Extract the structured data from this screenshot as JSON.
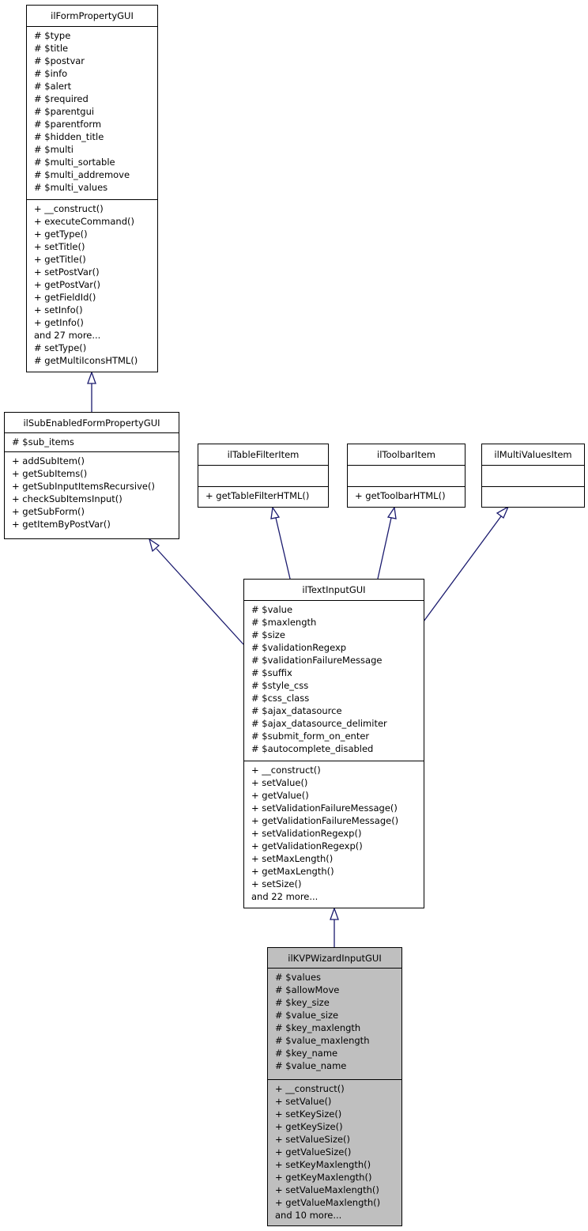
{
  "diagram": {
    "type": "uml-class-inheritance",
    "edge_color": "#1a1a6e",
    "focus_fill": "#bfbfbf",
    "classes": {
      "form_property": {
        "name": "ilFormPropertyGUI",
        "attributes": [
          "# $type",
          "# $title",
          "# $postvar",
          "# $info",
          "# $alert",
          "# $required",
          "# $parentgui",
          "# $parentform",
          "# $hidden_title",
          "# $multi",
          "# $multi_sortable",
          "# $multi_addremove",
          "# $multi_values"
        ],
        "methods": [
          "+ __construct()",
          "+ executeCommand()",
          "+ getType()",
          "+ setTitle()",
          "+ getTitle()",
          "+ setPostVar()",
          "+ getPostVar()",
          "+ getFieldId()",
          "+ setInfo()",
          "+ getInfo()",
          "and 27 more...",
          "# setType()",
          "# getMultiIconsHTML()"
        ]
      },
      "sub_enabled": {
        "name": "ilSubEnabledFormPropertyGUI",
        "attributes": [
          "# $sub_items"
        ],
        "methods": [
          "+ addSubItem()",
          "+ getSubItems()",
          "+ getSubInputItemsRecursive()",
          "+ checkSubItemsInput()",
          "+ getSubForm()",
          "+ getItemByPostVar()"
        ]
      },
      "table_filter_item": {
        "name": "ilTableFilterItem",
        "attributes": [],
        "methods": [
          "+ getTableFilterHTML()"
        ]
      },
      "toolbar_item": {
        "name": "ilToolbarItem",
        "attributes": [],
        "methods": [
          "+ getToolbarHTML()"
        ]
      },
      "multi_values_item": {
        "name": "ilMultiValuesItem",
        "attributes": [],
        "methods": []
      },
      "text_input": {
        "name": "ilTextInputGUI",
        "attributes": [
          "# $value",
          "# $maxlength",
          "# $size",
          "# $validationRegexp",
          "# $validationFailureMessage",
          "# $suffix",
          "# $style_css",
          "# $css_class",
          "# $ajax_datasource",
          "# $ajax_datasource_delimiter",
          "# $submit_form_on_enter",
          "# $autocomplete_disabled"
        ],
        "methods": [
          "+ __construct()",
          "+ setValue()",
          "+ getValue()",
          "+ setValidationFailureMessage()",
          "+ getValidationFailureMessage()",
          "+ setValidationRegexp()",
          "+ getValidationRegexp()",
          "+ setMaxLength()",
          "+ getMaxLength()",
          "+ setSize()",
          "and 22 more..."
        ]
      },
      "kvp_wizard": {
        "name": "ilKVPWizardInputGUI",
        "attributes": [
          "# $values",
          "# $allowMove",
          "# $key_size",
          "# $value_size",
          "# $key_maxlength",
          "# $value_maxlength",
          "# $key_name",
          "# $value_name"
        ],
        "methods": [
          "+ __construct()",
          "+ setValue()",
          "+ setKeySize()",
          "+ getKeySize()",
          "+ setValueSize()",
          "+ getValueSize()",
          "+ setKeyMaxlength()",
          "+ getKeyMaxlength()",
          "+ setValueMaxlength()",
          "+ getValueMaxlength()",
          "and 10 more..."
        ]
      }
    },
    "inheritance": [
      {
        "child": "ilSubEnabledFormPropertyGUI",
        "parent": "ilFormPropertyGUI"
      },
      {
        "child": "ilTextInputGUI",
        "parent": "ilSubEnabledFormPropertyGUI"
      },
      {
        "child": "ilTextInputGUI",
        "parent": "ilTableFilterItem"
      },
      {
        "child": "ilTextInputGUI",
        "parent": "ilToolbarItem"
      },
      {
        "child": "ilTextInputGUI",
        "parent": "ilMultiValuesItem"
      },
      {
        "child": "ilKVPWizardInputGUI",
        "parent": "ilTextInputGUI"
      }
    ]
  }
}
